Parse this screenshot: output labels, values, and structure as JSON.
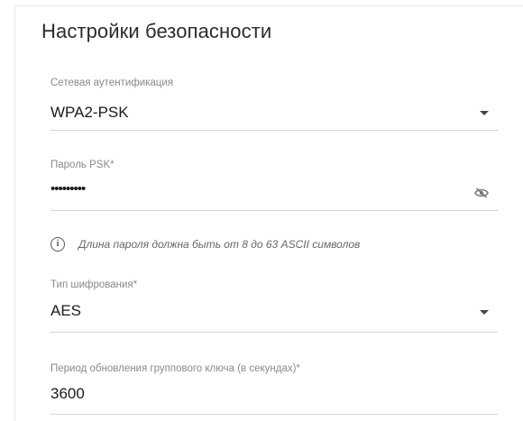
{
  "section": {
    "title": "Настройки безопасности"
  },
  "auth": {
    "label": "Сетевая аутентификация",
    "value": "WPA2-PSK"
  },
  "psk": {
    "label": "Пароль PSK*",
    "value": "•••••••••"
  },
  "hint": {
    "text": "Длина пароля должна быть от 8 до 63 ASCII символов",
    "icon": "info-icon"
  },
  "encryption": {
    "label": "Тип шифрования*",
    "value": "AES"
  },
  "group_key": {
    "label": "Период обновления группового ключа (в секундах)*",
    "value": "3600"
  },
  "icons": {
    "dropdown": "chevron-down-icon",
    "password_visibility": "eye-off-icon"
  }
}
